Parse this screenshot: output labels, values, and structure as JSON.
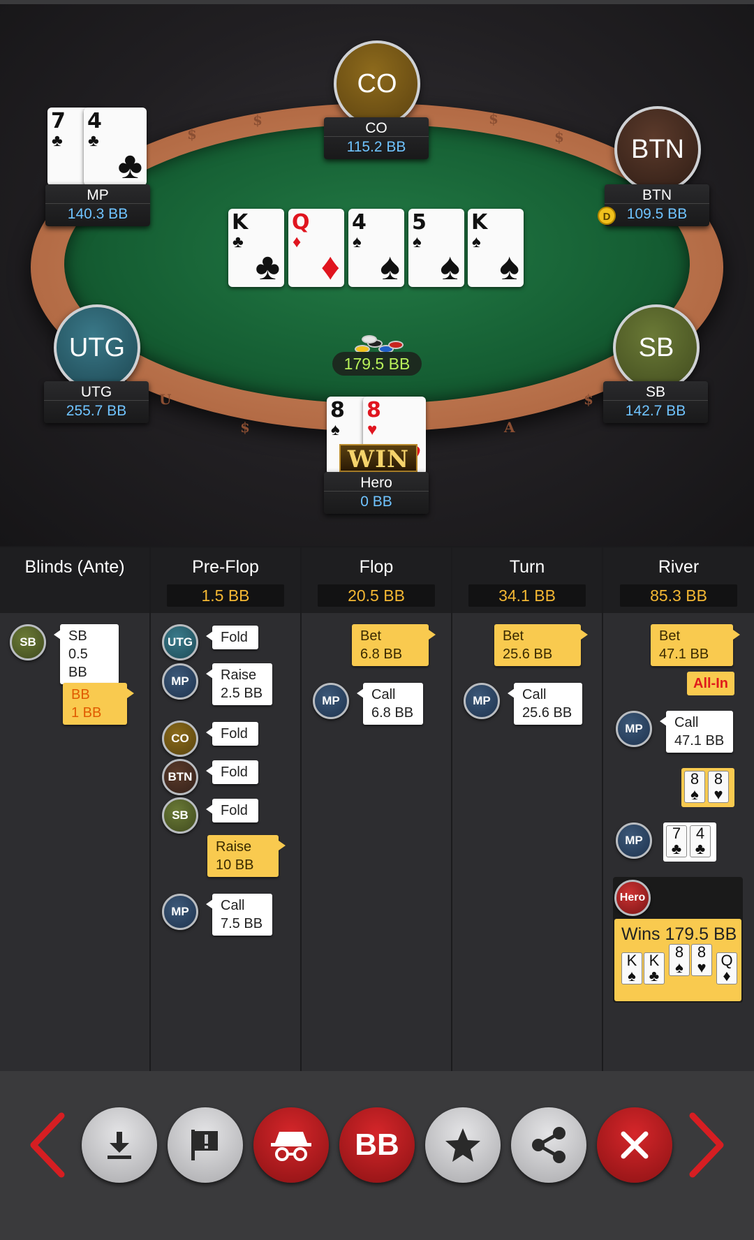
{
  "seats": {
    "co": {
      "avatar": "CO",
      "name": "CO",
      "stack": "115.2 BB"
    },
    "btn": {
      "avatar": "BTN",
      "name": "BTN",
      "stack": "109.5 BB",
      "dealer": "D"
    },
    "mp": {
      "name": "MP",
      "stack": "140.3 BB",
      "cards": [
        {
          "rank": "7",
          "suit": "♣"
        },
        {
          "rank": "4",
          "suit": "♣"
        }
      ]
    },
    "utg": {
      "avatar": "UTG",
      "name": "UTG",
      "stack": "255.7 BB"
    },
    "sb": {
      "avatar": "SB",
      "name": "SB",
      "stack": "142.7 BB"
    },
    "hero": {
      "name": "Hero",
      "stack": "0 BB",
      "cards": [
        {
          "rank": "8",
          "suit": "♠"
        },
        {
          "rank": "8",
          "suit": "♥"
        }
      ],
      "banner": "WIN"
    }
  },
  "board": [
    {
      "rank": "K",
      "suit": "♣"
    },
    {
      "rank": "Q",
      "suit": "♦"
    },
    {
      "rank": "4",
      "suit": "♠"
    },
    {
      "rank": "5",
      "suit": "♠"
    },
    {
      "rank": "K",
      "suit": "♠"
    }
  ],
  "pot": "179.5 BB",
  "streets": {
    "blinds": {
      "title": "Blinds (Ante)"
    },
    "preflop": {
      "title": "Pre-Flop",
      "pot": "1.5 BB"
    },
    "flop": {
      "title": "Flop",
      "pot": "20.5 BB"
    },
    "turn": {
      "title": "Turn",
      "pot": "34.1 BB"
    },
    "river": {
      "title": "River",
      "pot": "85.3 BB"
    }
  },
  "actions": {
    "blinds": [
      {
        "player": "SB",
        "line1": "SB",
        "line2": "0.5 BB"
      },
      {
        "player": "BB",
        "line1": "BB",
        "line2": "1 BB"
      }
    ],
    "preflop": [
      {
        "player": "UTG",
        "line1": "Fold"
      },
      {
        "player": "MP",
        "line1": "Raise",
        "line2": "2.5 BB"
      },
      {
        "player": "CO",
        "line1": "Fold"
      },
      {
        "player": "BTN",
        "line1": "Fold"
      },
      {
        "player": "SB",
        "line1": "Fold"
      },
      {
        "player": "Hero",
        "line1": "Raise",
        "line2": "10 BB"
      },
      {
        "player": "MP",
        "line1": "Call",
        "line2": "7.5 BB"
      }
    ],
    "flop": [
      {
        "player": "Hero",
        "line1": "Bet",
        "line2": "6.8 BB"
      },
      {
        "player": "MP",
        "line1": "Call",
        "line2": "6.8 BB"
      }
    ],
    "turn": [
      {
        "player": "Hero",
        "line1": "Bet",
        "line2": "25.6 BB"
      },
      {
        "player": "MP",
        "line1": "Call",
        "line2": "25.6 BB"
      }
    ],
    "river": [
      {
        "player": "Hero",
        "line1": "Bet",
        "line2": "47.1 BB",
        "tag": "All-In"
      },
      {
        "player": "MP",
        "line1": "Call",
        "line2": "47.1 BB"
      }
    ]
  },
  "showdown": {
    "hero_cards": [
      {
        "rank": "8",
        "suit": "♠"
      },
      {
        "rank": "8",
        "suit": "♥"
      }
    ],
    "mp_cards": [
      {
        "rank": "7",
        "suit": "♣"
      },
      {
        "rank": "4",
        "suit": "♣"
      }
    ],
    "winner_chip": "Hero",
    "winner_text": "Wins 179.5 BB",
    "winning_hand": [
      {
        "rank": "K",
        "suit": "♠"
      },
      {
        "rank": "K",
        "suit": "♣"
      },
      {
        "rank": "8",
        "suit": "♠"
      },
      {
        "rank": "8",
        "suit": "♥"
      },
      {
        "rank": "Q",
        "suit": "♦"
      }
    ]
  },
  "chip_labels": {
    "mp": "MP",
    "utg": "UTG",
    "co": "CO",
    "btn": "BTN",
    "sb": "SB"
  },
  "controls": {
    "prev": "chevron-left-icon",
    "download": "download-icon",
    "report": "report-flag-icon",
    "incognito": "incognito-icon",
    "bb_label": "BB",
    "favorite": "star-icon",
    "share": "share-icon",
    "close": "close-icon",
    "next": "chevron-right-icon"
  },
  "colors": {
    "accent": "#f9ca4f",
    "pot_text": "#b8f25a",
    "stack_text": "#6fc3ff",
    "danger": "#d5262a"
  }
}
